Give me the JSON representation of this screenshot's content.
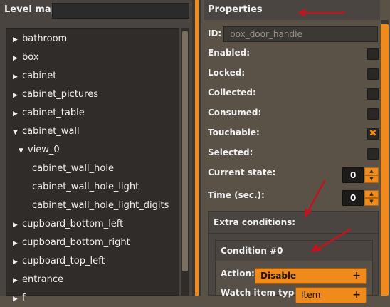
{
  "level_map": {
    "title": "Level map",
    "search_value": "",
    "items": [
      {
        "label": "bathroom",
        "arrow": "▶",
        "indent": 0
      },
      {
        "label": "box",
        "arrow": "▶",
        "indent": 0
      },
      {
        "label": "cabinet",
        "arrow": "▶",
        "indent": 0
      },
      {
        "label": "cabinet_pictures",
        "arrow": "▶",
        "indent": 0
      },
      {
        "label": "cabinet_table",
        "arrow": "▶",
        "indent": 0
      },
      {
        "label": "cabinet_wall",
        "arrow": "▼",
        "indent": 0
      },
      {
        "label": "view_0",
        "arrow": "▼",
        "indent": 1
      },
      {
        "label": "cabinet_wall_hole",
        "arrow": "",
        "indent": 2
      },
      {
        "label": "cabinet_wall_hole_light",
        "arrow": "",
        "indent": 2
      },
      {
        "label": "cabinet_wall_hole_light_digits",
        "arrow": "",
        "indent": 2
      },
      {
        "label": "cupboard_bottom_left",
        "arrow": "▶",
        "indent": 0
      },
      {
        "label": "cupboard_bottom_right",
        "arrow": "▶",
        "indent": 0
      },
      {
        "label": "cupboard_top_left",
        "arrow": "▶",
        "indent": 0
      },
      {
        "label": "entrance",
        "arrow": "▶",
        "indent": 0
      },
      {
        "label": "f",
        "arrow": "▶",
        "indent": 0
      }
    ]
  },
  "properties": {
    "title": "Properties",
    "id_label": "ID:",
    "id_value": "box_door_handle",
    "enabled_label": "Enabled:",
    "locked_label": "Locked:",
    "collected_label": "Collected:",
    "consumed_label": "Consumed:",
    "touchable_label": "Touchable:",
    "touchable_mark": "✖",
    "selected_label": "Selected:",
    "current_state_label": "Current state:",
    "current_state_value": "0",
    "time_label": "Time (sec.):",
    "time_value": "0",
    "spin_up": "▲",
    "spin_down": "▼",
    "checkbox_states": {
      "enabled": false,
      "locked": false,
      "collected": false,
      "consumed": false,
      "touchable": true,
      "selected": false
    }
  },
  "extra_conditions": {
    "title": "Extra conditions:",
    "condition_title": "Condition #0",
    "action_label": "Action:",
    "action_value": "Disable",
    "watch_label": "Watch item type:",
    "watch_value": "Item",
    "plus": "+"
  },
  "colors": {
    "accent": "#f08a1a",
    "annotation_arrow": "#c0151e"
  }
}
